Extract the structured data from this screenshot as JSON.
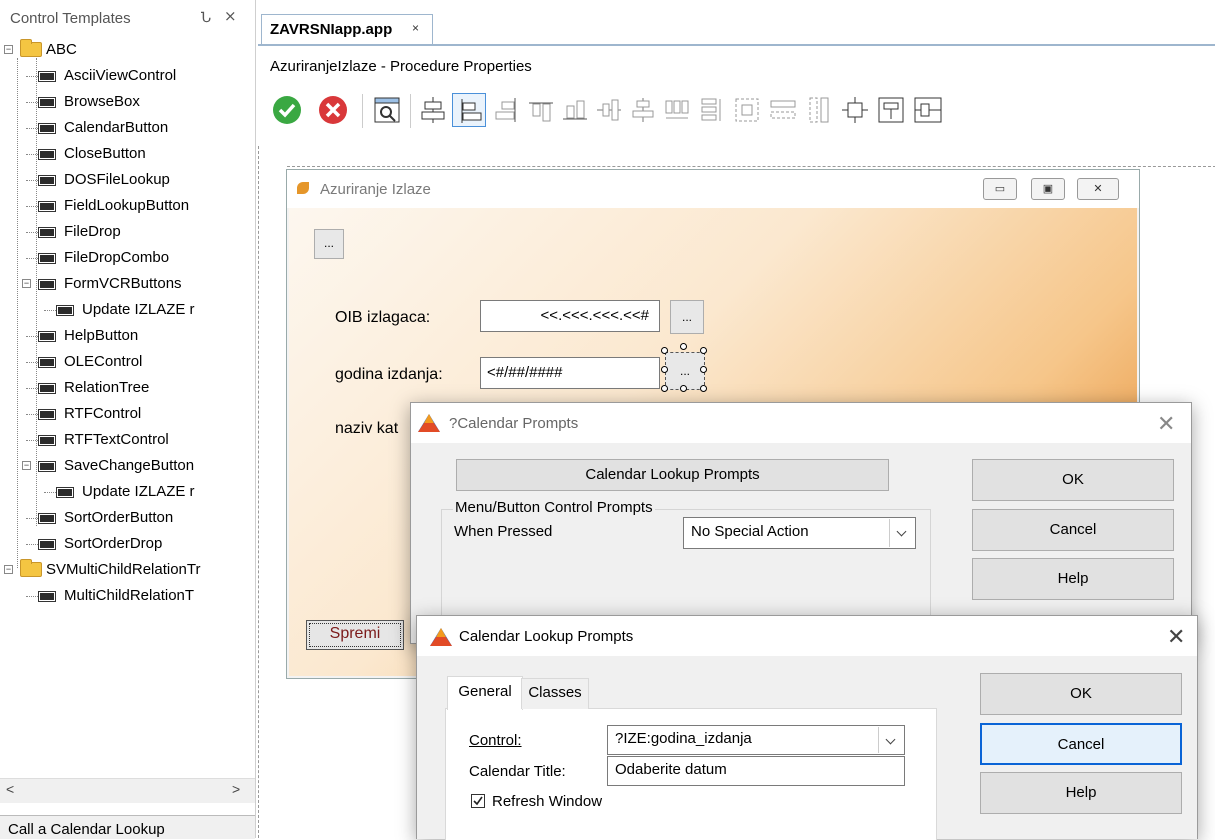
{
  "left_panel": {
    "title": "Control Templates",
    "pin_icon": "Ն",
    "close_icon": "⨯",
    "tree": [
      {
        "label": "ABC",
        "level": 0,
        "type": "folder",
        "expanded": true
      },
      {
        "label": "AsciiViewControl",
        "level": 1,
        "type": "item"
      },
      {
        "label": "BrowseBox",
        "level": 1,
        "type": "item"
      },
      {
        "label": "CalendarButton",
        "level": 1,
        "type": "item"
      },
      {
        "label": "CloseButton",
        "level": 1,
        "type": "item"
      },
      {
        "label": "DOSFileLookup",
        "level": 1,
        "type": "item"
      },
      {
        "label": "FieldLookupButton",
        "level": 1,
        "type": "item"
      },
      {
        "label": "FileDrop",
        "level": 1,
        "type": "item"
      },
      {
        "label": "FileDropCombo",
        "level": 1,
        "type": "item"
      },
      {
        "label": "FormVCRButtons",
        "level": 1,
        "type": "item",
        "expanded": true
      },
      {
        "label": "Update IZLAZE r",
        "level": 2,
        "type": "item"
      },
      {
        "label": "HelpButton",
        "level": 1,
        "type": "item"
      },
      {
        "label": "OLEControl",
        "level": 1,
        "type": "item"
      },
      {
        "label": "RelationTree",
        "level": 1,
        "type": "item"
      },
      {
        "label": "RTFControl",
        "level": 1,
        "type": "item"
      },
      {
        "label": "RTFTextControl",
        "level": 1,
        "type": "item"
      },
      {
        "label": "SaveChangeButton",
        "level": 1,
        "type": "item",
        "expanded": true
      },
      {
        "label": "Update IZLAZE r",
        "level": 2,
        "type": "item"
      },
      {
        "label": "SortOrderButton",
        "level": 1,
        "type": "item"
      },
      {
        "label": "SortOrderDrop",
        "level": 1,
        "type": "item"
      },
      {
        "label": "SVMultiChildRelationTr",
        "level": 0,
        "type": "folder",
        "expanded": true
      },
      {
        "label": "MultiChildRelationT",
        "level": 1,
        "type": "item"
      }
    ],
    "scroll_left": "<",
    "scroll_right": ">",
    "status": "Call a Calendar Lookup"
  },
  "tab": {
    "label": "ZAVRSNIapp.app",
    "close": "×"
  },
  "properties_title": "AzuriranjeIzlaze - Procedure Properties",
  "toolbar_icons": [
    "ok-icon",
    "cancel-icon",
    "preview-icon",
    "align-center-icon",
    "align-left-icon",
    "align-right-icon",
    "align-top-icon",
    "align-bottom-icon",
    "align-vcenter-icon",
    "align-hcenter-icon",
    "spread-horizontal-icon",
    "spread-vertical-icon",
    "make-same-size-icon",
    "make-same-width-icon",
    "make-same-height-icon",
    "center-in-window-icon",
    "center-horizontal-icon",
    "center-vertical-icon"
  ],
  "designed_window": {
    "title": "Azuriranje Izlaze",
    "top_button": "...",
    "oib_label": "OIB izlagaca:",
    "oib_value": "<<.<<<.<<<.<<#",
    "oib_button": "...",
    "godina_label": "godina izdanja:",
    "godina_value": "<#/##/####",
    "godina_button": "...",
    "naziv_label": "naziv kat",
    "save_button": "Spremi"
  },
  "calendar_prompts_dialog": {
    "title": "?Calendar Prompts",
    "lookup_button": "Calendar Lookup Prompts",
    "group_title": "Menu/Button Control Prompts",
    "when_pressed_label": "When Pressed",
    "when_pressed_value": "No Special Action",
    "ok": "OK",
    "cancel": "Cancel",
    "help": "Help"
  },
  "calendar_lookup_dialog": {
    "title": "Calendar Lookup Prompts",
    "tabs": [
      "General",
      "Classes"
    ],
    "control_label": "Control:",
    "control_value": "?IZE:godina_izdanja",
    "calendar_title_label": "Calendar Title:",
    "calendar_title_value": "Odaberite datum",
    "refresh_window_label": "Refresh Window",
    "refresh_checked": true,
    "ok": "OK",
    "cancel": "Cancel",
    "help": "Help"
  },
  "colors": {
    "accent_tab_border": "#9eb6ce",
    "save_text": "#7b1a1a",
    "ok_green": "#3aa842",
    "cancel_red": "#d9383a"
  }
}
